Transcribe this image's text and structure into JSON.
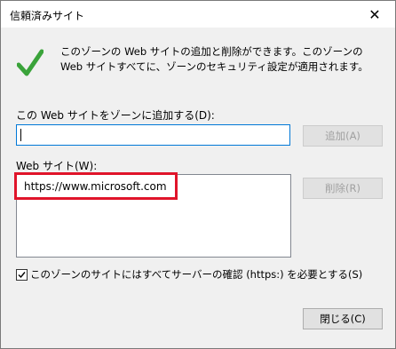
{
  "window": {
    "title": "信頼済みサイト",
    "close_glyph": "✕"
  },
  "description": "このゾーンの Web サイトの追加と削除ができます。このゾーンの Web サイトすべてに、ゾーンのセキュリティ設定が適用されます。",
  "add_section": {
    "label": "この Web サイトをゾーンに追加する(D):",
    "input_value": "",
    "add_button": "追加(A)"
  },
  "sites_section": {
    "label": "Web サイト(W):",
    "items": [
      "https://www.microsoft.com"
    ],
    "remove_button": "削除(R)"
  },
  "https_checkbox": {
    "checked": true,
    "label": "このゾーンのサイトにはすべてサーバーの確認 (https:) を必要とする(S)"
  },
  "close_button": "閉じる(C)",
  "colors": {
    "check_icon": "#3aa33a",
    "highlight": "#e0142a",
    "focus_border": "#0078d7"
  },
  "icons": {
    "success": "checkmark-icon",
    "close": "close-icon"
  }
}
